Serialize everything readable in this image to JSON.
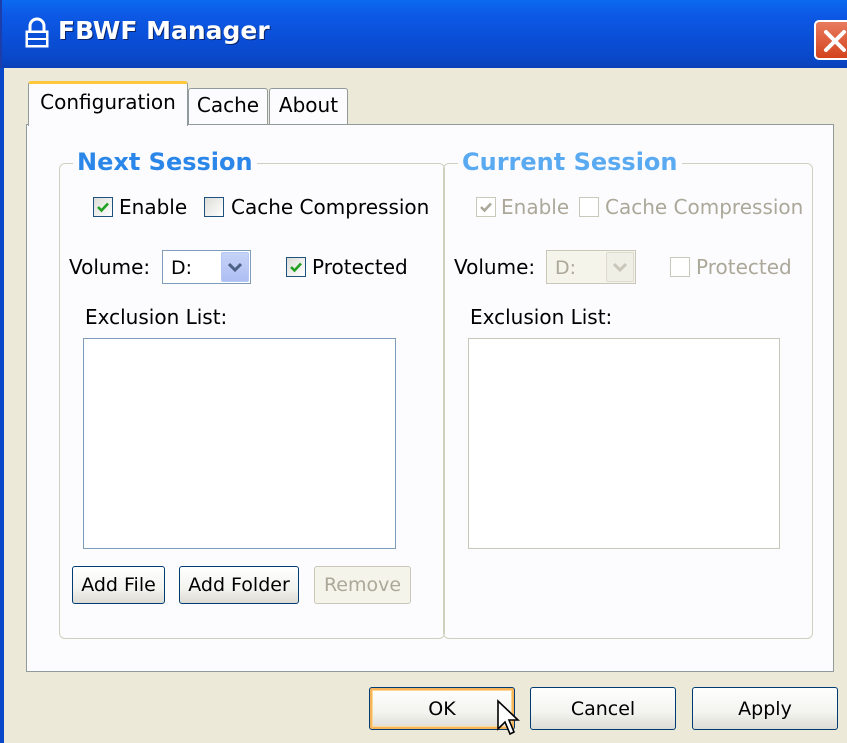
{
  "window": {
    "title": "FBWF Manager"
  },
  "tabs": [
    {
      "label": "Configuration",
      "active": true
    },
    {
      "label": "Cache",
      "active": false
    },
    {
      "label": "About",
      "active": false
    }
  ],
  "next_session": {
    "title": "Next Session",
    "enable": {
      "label": "Enable",
      "checked": true
    },
    "cache_compression": {
      "label": "Cache Compression",
      "checked": false
    },
    "volume_label": "Volume:",
    "volume_value": "D:",
    "protected": {
      "label": "Protected",
      "checked": true
    },
    "exclusion_label": "Exclusion List:",
    "add_file": "Add File",
    "add_folder": "Add Folder",
    "remove": "Remove"
  },
  "current_session": {
    "title": "Current Session",
    "enable": {
      "label": "Enable",
      "checked": true
    },
    "cache_compression": {
      "label": "Cache Compression",
      "checked": false
    },
    "volume_label": "Volume:",
    "volume_value": "D:",
    "protected": {
      "label": "Protected",
      "checked": false
    },
    "exclusion_label": "Exclusion List:"
  },
  "buttons": {
    "ok": "OK",
    "cancel": "Cancel",
    "apply": "Apply"
  },
  "colors": {
    "titlebar": "#0a4fd8",
    "group_title": "#2a86e8",
    "dialog_bg": "#ece9d8"
  }
}
